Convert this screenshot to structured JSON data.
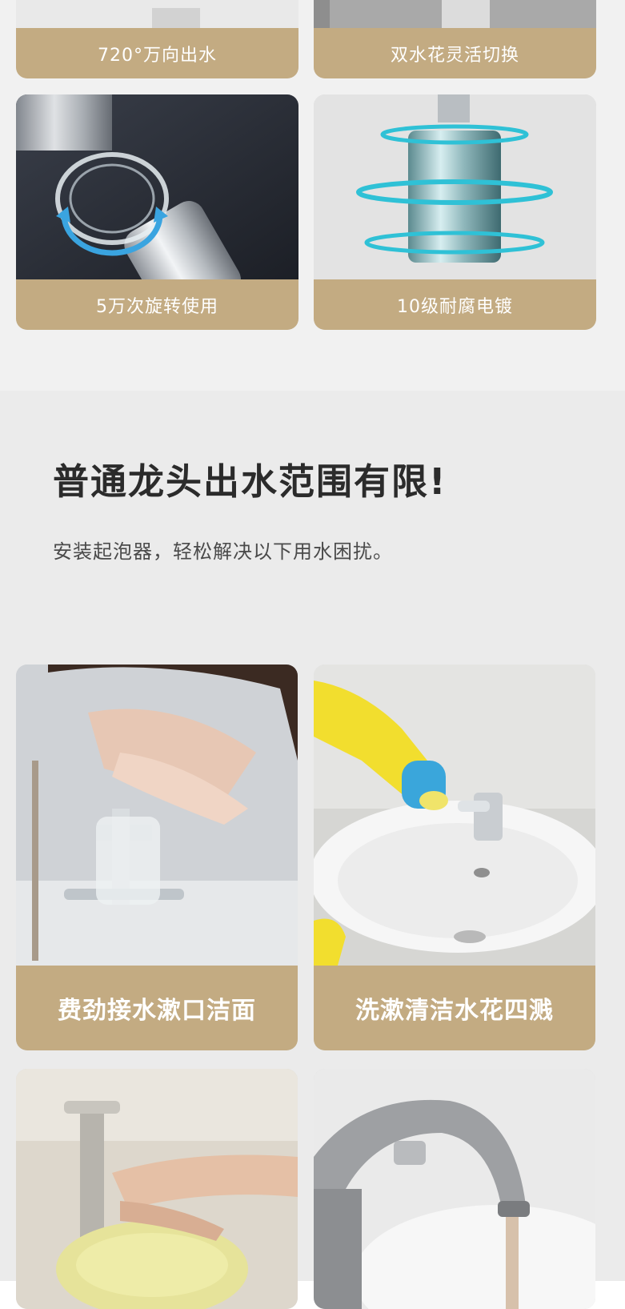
{
  "features": {
    "items": [
      {
        "caption": "720°万向出水"
      },
      {
        "caption": "双水花灵活切换"
      },
      {
        "caption": "5万次旋转使用"
      },
      {
        "caption": "10级耐腐电镀"
      }
    ]
  },
  "problem": {
    "headline": "普通龙头出水范围有限!",
    "subline": "安装起泡器，轻松解决以下用水困扰。",
    "cards": [
      {
        "caption": "费劲接水漱口洁面"
      },
      {
        "caption": "洗漱清洁水花四溅"
      }
    ]
  },
  "colors": {
    "caption_bg": "#c3ab82",
    "top_bg": "#f1f1f1",
    "mid_bg": "#ebebeb"
  }
}
